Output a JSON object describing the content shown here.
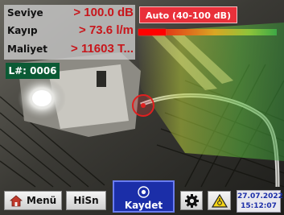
{
  "readout": {
    "rows": [
      {
        "label": "Seviye",
        "value": "> 100.0 dB"
      },
      {
        "label": "Kayıp",
        "value": "> 73.6 l/m"
      },
      {
        "label": "Maliyet",
        "value": "> 11603 T..."
      }
    ],
    "location_id": "L#: 0006"
  },
  "scale": {
    "mode_label": "Auto (40-100 dB)",
    "level_fraction": 1.0,
    "colors": {
      "low": "#3da845",
      "mid": "#d9a623",
      "high": "#e01818"
    }
  },
  "toolbar": {
    "menu_label": "Menü",
    "hisn_label": "HiSn",
    "save_label": "Kaydet",
    "date": "27.07.2022",
    "time": "15:12:07"
  },
  "icons": {
    "menu": "home-icon",
    "save": "record-icon",
    "settings": "gear-icon",
    "warning": "warning-triangle-icon",
    "target": "target-circle-icon"
  },
  "colors": {
    "accent_red": "#c8161b",
    "mode_button": "#e9303a",
    "save_button": "#1b2ea8",
    "location_badge": "#0b5a34"
  }
}
